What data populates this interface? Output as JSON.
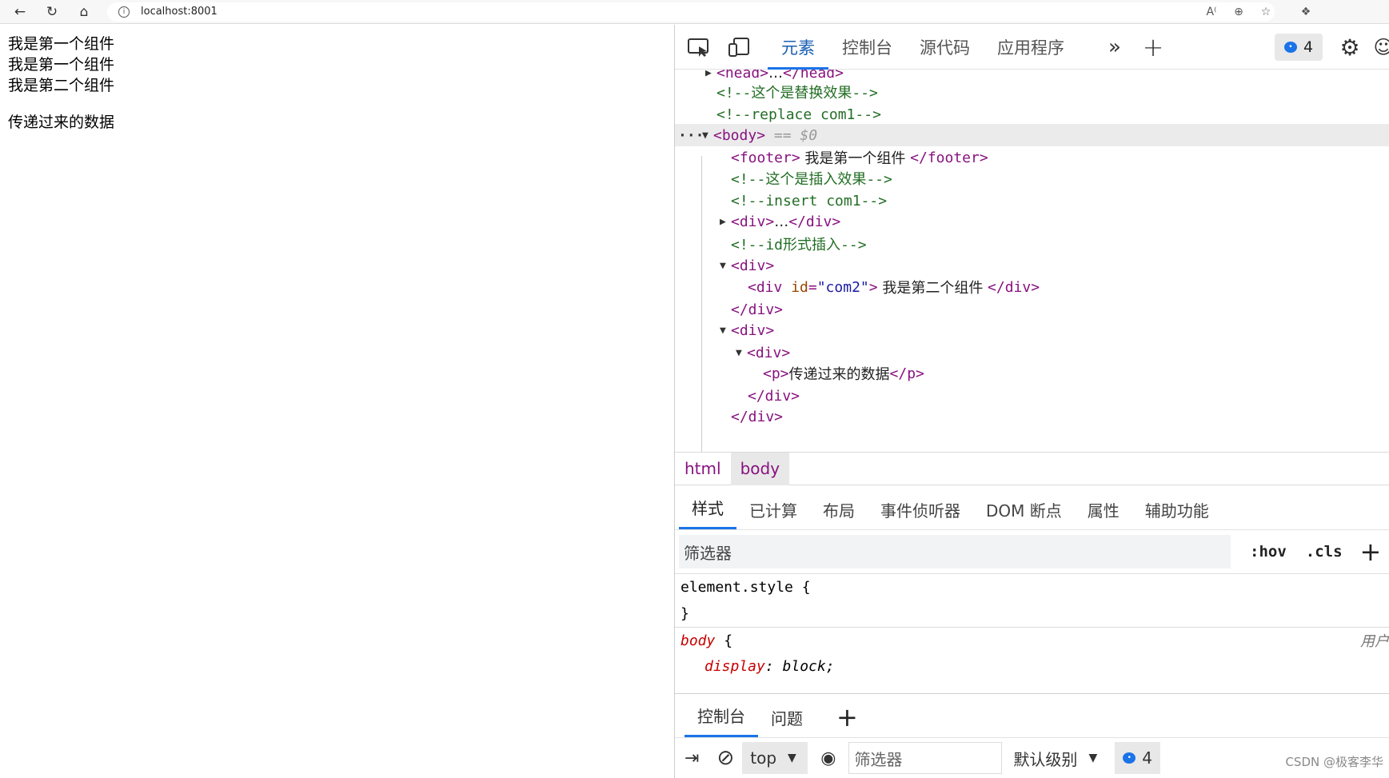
{
  "browser": {
    "url": "localhost:8001"
  },
  "page": {
    "lines": [
      "我是第一个组件",
      "我是第一个组件",
      "我是第二个组件"
    ],
    "paragraph": "传递过来的数据"
  },
  "devtools": {
    "tabs": [
      "元素",
      "控制台",
      "源代码",
      "应用程序"
    ],
    "active_tab": "元素",
    "issues_count": "4",
    "dom": {
      "head": "head",
      "head_ellipsis": "…",
      "comment_replace_cn": "<!--这个是替换效果-->",
      "comment_replace": "<!--replace com1-->",
      "body": "body",
      "body_marker": "== $0",
      "footer_text": " 我是第一个组件 ",
      "comment_insert_cn": "<!--这个是插入效果-->",
      "comment_insert": "<!--insert com1-->",
      "div_collapsed": "…",
      "comment_id": "<!--id形式插入-->",
      "div_id_attr": "id",
      "div_id_value": "\"com2\"",
      "div_id_text": " 我是第二个组件 ",
      "p_text": "传递过来的数据",
      "dots": "···"
    },
    "breadcrumbs": [
      "html",
      "body"
    ],
    "subtabs": [
      "样式",
      "已计算",
      "布局",
      "事件侦听器",
      "DOM 断点",
      "属性",
      "辅助功能"
    ],
    "filter_placeholder": "筛选器",
    "hov": ":hov",
    "cls": ".cls",
    "styles": {
      "element_style": "element.style {",
      "close_brace": "}",
      "body_selector": "body",
      "open_brace": " {",
      "origin": "用户",
      "prop": "display",
      "value": "block;"
    },
    "drawer": {
      "tabs": [
        "控制台",
        "问题"
      ],
      "context": "top",
      "filter_placeholder": "筛选器",
      "level": "默认级别",
      "count": "4"
    }
  },
  "watermark": "CSDN @极客李华"
}
